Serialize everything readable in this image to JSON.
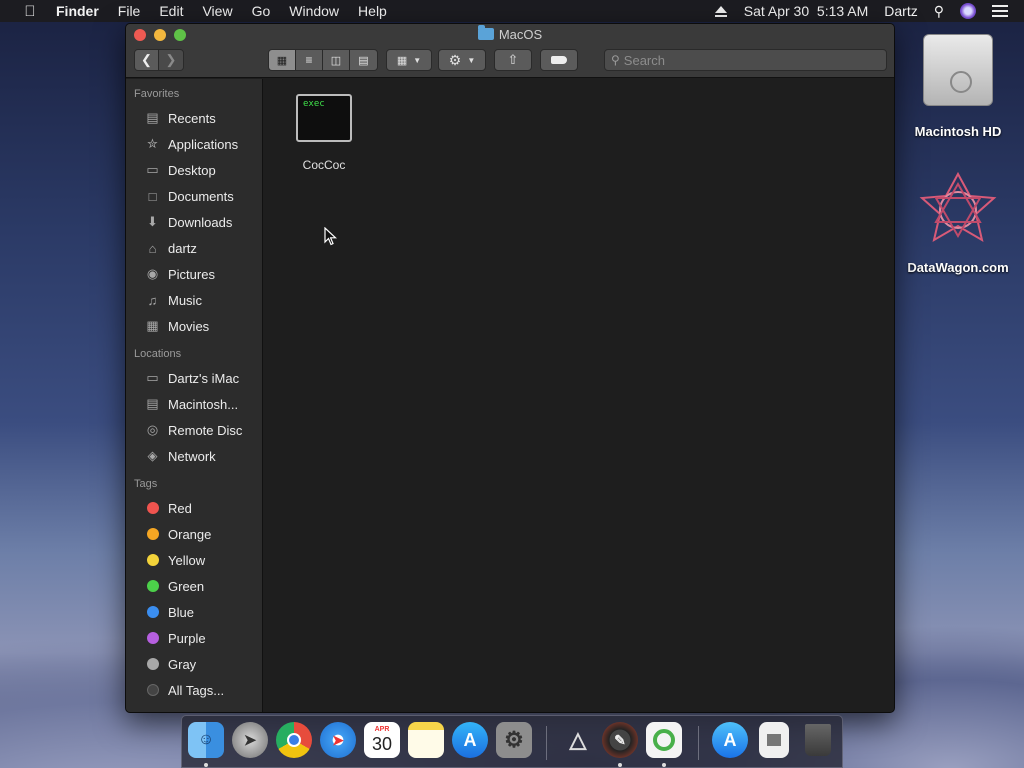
{
  "menubar": {
    "app": "Finder",
    "menus": [
      "File",
      "Edit",
      "View",
      "Go",
      "Window",
      "Help"
    ],
    "datetime": "Sat Apr 30  5:13 AM",
    "user": "Dartz"
  },
  "window": {
    "title": "MacOS",
    "search_placeholder": "Search"
  },
  "sidebar": {
    "favorites_header": "Favorites",
    "favorites": [
      {
        "label": "Recents",
        "icon": "recents-icon"
      },
      {
        "label": "Applications",
        "icon": "applications-icon"
      },
      {
        "label": "Desktop",
        "icon": "desktop-icon"
      },
      {
        "label": "Documents",
        "icon": "documents-icon"
      },
      {
        "label": "Downloads",
        "icon": "downloads-icon"
      },
      {
        "label": "dartz",
        "icon": "home-icon"
      },
      {
        "label": "Pictures",
        "icon": "camera-icon"
      },
      {
        "label": "Music",
        "icon": "music-note-icon"
      },
      {
        "label": "Movies",
        "icon": "film-icon"
      }
    ],
    "locations_header": "Locations",
    "locations": [
      {
        "label": "Dartz's iMac",
        "icon": "imac-icon"
      },
      {
        "label": "Macintosh...",
        "icon": "disk-icon"
      },
      {
        "label": "Remote Disc",
        "icon": "disc-icon"
      },
      {
        "label": "Network",
        "icon": "globe-icon"
      }
    ],
    "tags_header": "Tags",
    "tags": [
      {
        "label": "Red",
        "color": "#f0544f"
      },
      {
        "label": "Orange",
        "color": "#f5a623"
      },
      {
        "label": "Yellow",
        "color": "#f3d33a"
      },
      {
        "label": "Green",
        "color": "#4cd04a"
      },
      {
        "label": "Blue",
        "color": "#3b8ef0"
      },
      {
        "label": "Purple",
        "color": "#b65fe0"
      },
      {
        "label": "Gray",
        "color": "#a8a8a8"
      },
      {
        "label": "All Tags...",
        "color": "#555555"
      }
    ]
  },
  "content": {
    "files": [
      {
        "name": "CocCoc",
        "icon_text": "exec"
      }
    ]
  },
  "desktop": {
    "icons": [
      {
        "label": "Macintosh HD"
      },
      {
        "label": "DataWagon.com"
      }
    ]
  },
  "dock": {
    "apps": [
      "Finder",
      "Launchpad",
      "Chrome",
      "Safari",
      "Calendar",
      "Notes",
      "App Store",
      "System Preferences",
      "Utility",
      "Instruments",
      "Coc Coc",
      "App Store Downloads",
      "Document",
      "Trash"
    ],
    "calendar_month": "APR",
    "calendar_day": "30"
  }
}
